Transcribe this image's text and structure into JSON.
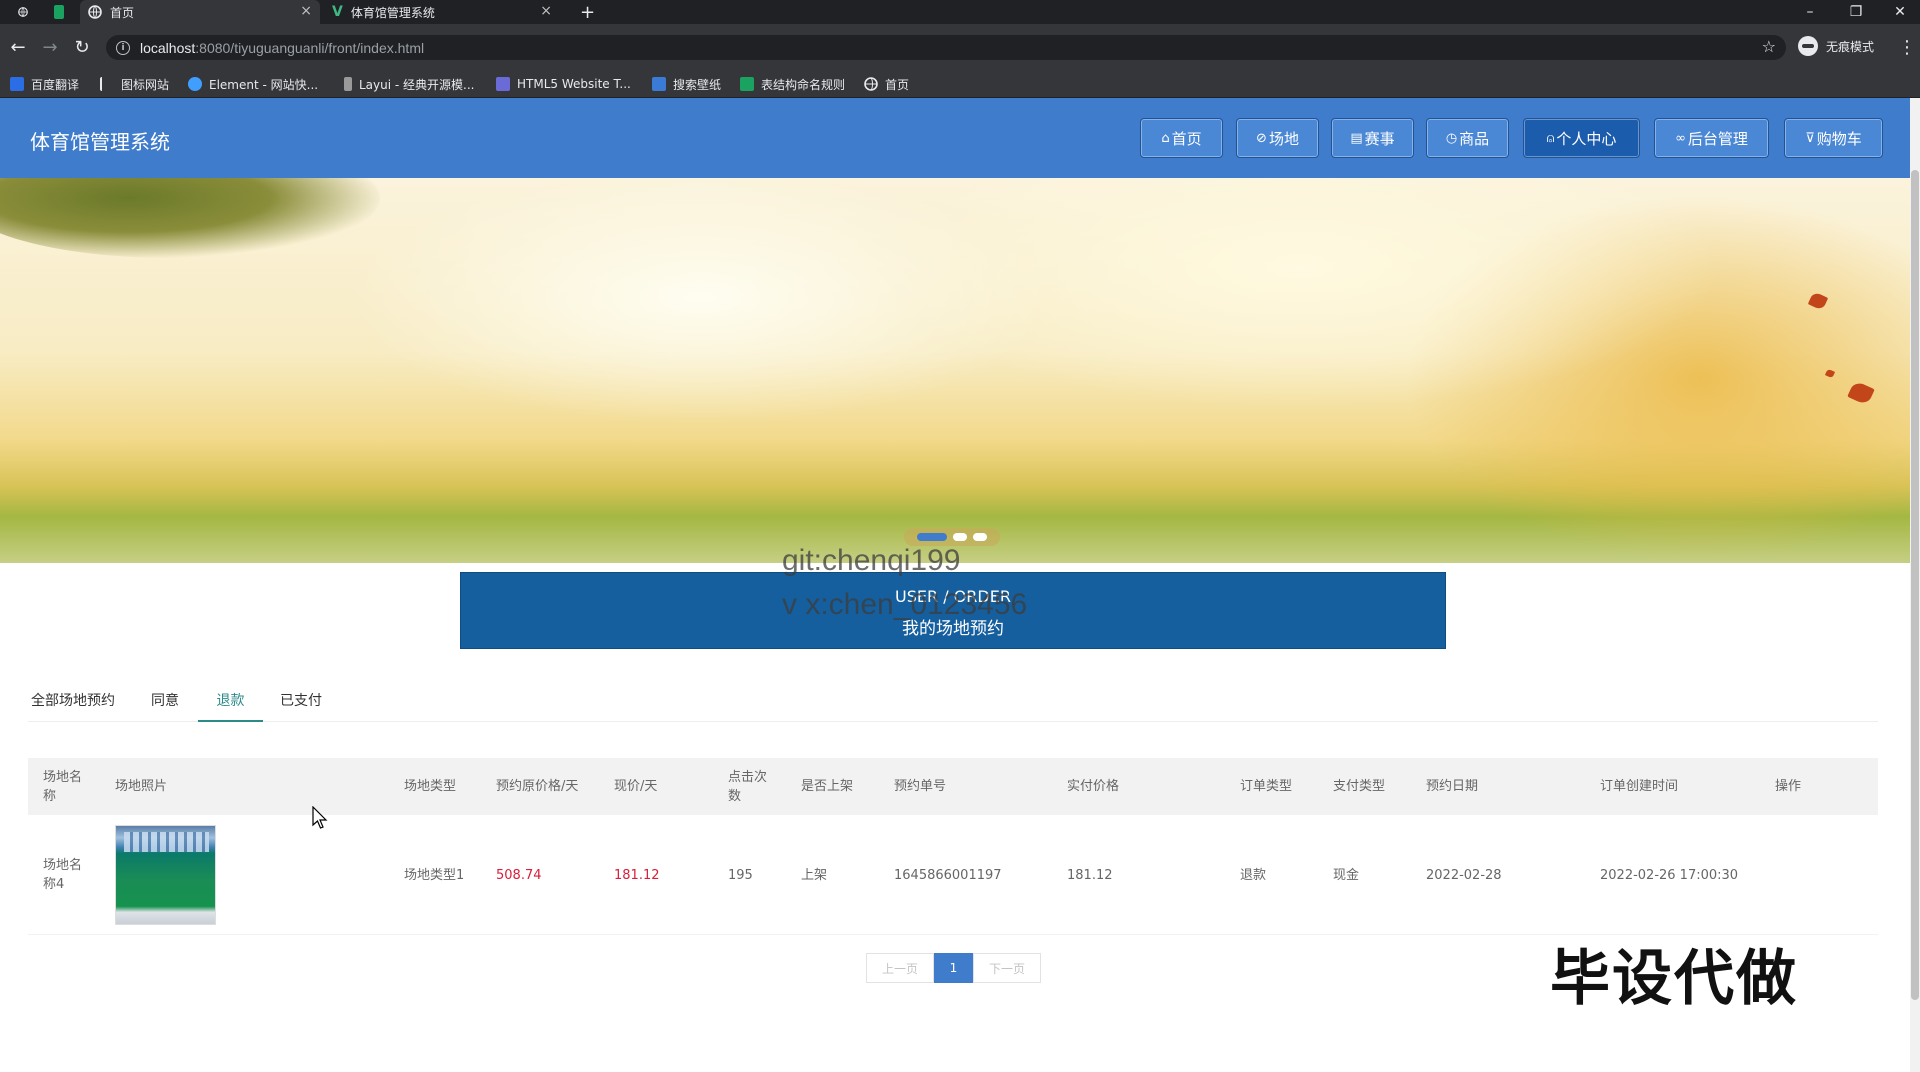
{
  "browser": {
    "tabs": [
      {
        "title": "首页",
        "active": true
      },
      {
        "title": "体育馆管理系统",
        "active": false
      }
    ],
    "new_tab": "+",
    "url_host": "localhost",
    "url_path": ":8080/tiyuguanguanli/front/index.html",
    "profile_label": "无痕模式",
    "bookmarks": [
      {
        "label": "百度翻译",
        "icon": "baidu-translate-icon",
        "color": "#2b6de5"
      },
      {
        "label": "图标网站",
        "icon": "flag-icon",
        "color": "#e8eaed"
      },
      {
        "label": "Element - 网站快...",
        "icon": "element-icon",
        "color": "#409eff"
      },
      {
        "label": "Layui - 经典开源模...",
        "icon": "layui-icon",
        "color": "#bdbdbd"
      },
      {
        "label": "HTML5 Website T...",
        "icon": "html5-icon",
        "color": "#6b6bd8"
      },
      {
        "label": "搜索壁纸",
        "icon": "wallpaper-icon",
        "color": "#3a7bd5"
      },
      {
        "label": "表结构命名规则",
        "icon": "sheet-icon",
        "color": "#1aa260"
      },
      {
        "label": "首页",
        "icon": "globe-icon",
        "color": "#e8eaed"
      }
    ]
  },
  "header": {
    "site_title": "体育馆管理系统",
    "nav": [
      {
        "label": "首页",
        "icon": "⌂"
      },
      {
        "label": "场地",
        "icon": "⊘"
      },
      {
        "label": "赛事",
        "icon": "▤"
      },
      {
        "label": "商品",
        "icon": "◷"
      },
      {
        "label": "个人中心",
        "icon": "⍝",
        "active": true
      },
      {
        "label": "后台管理",
        "icon": "∞"
      },
      {
        "label": "购物车",
        "icon": "⊽"
      }
    ]
  },
  "watermarks": {
    "git": "git:chenqi199",
    "wechat": "v x:chen_0123456",
    "corner": "毕设代做"
  },
  "section": {
    "en": "USER / ORDER",
    "cn": "我的场地预约"
  },
  "order_tabs": [
    "全部场地预约",
    "同意",
    "退款",
    "已支付"
  ],
  "active_tab": "退款",
  "table": {
    "headers": [
      "场地名称",
      "场地照片",
      "场地类型",
      "预约原价格/天",
      "现价/天",
      "点击次数",
      "是否上架",
      "预约单号",
      "实付价格",
      "订单类型",
      "支付类型",
      "预约日期",
      "订单创建时间",
      "操作"
    ],
    "rows": [
      {
        "name": "场地名称4",
        "type": "场地类型1",
        "original_price": "508.74",
        "price": "181.12",
        "clicks": "195",
        "on_shelf": "上架",
        "order_no": "1645866001197",
        "paid": "181.12",
        "order_type": "退款",
        "pay_type": "现金",
        "date": "2022-02-28",
        "created": "2022-02-26 17:00:30"
      }
    ]
  },
  "pager": {
    "prev": "上一页",
    "current": "1",
    "next": "下一页"
  },
  "colors": {
    "header_blue": "#3f7ccc",
    "section_blue": "#165f9e",
    "active_tab": "#2d8a8a",
    "price_red": "#d81e3a"
  }
}
